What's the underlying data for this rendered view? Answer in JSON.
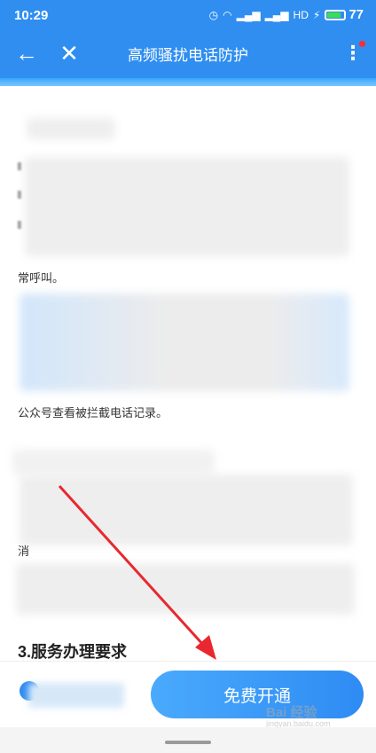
{
  "status_bar": {
    "time": "10:29",
    "icons": [
      "alarm-icon",
      "wifi-icon",
      "signal-icon",
      "signal-icon",
      "hd-icon",
      "charging-icon"
    ],
    "battery": "77"
  },
  "header": {
    "title": "高频骚扰电话防护",
    "back_icon": "←",
    "close_icon": "✕",
    "more_icon": "⋮"
  },
  "content": {
    "line_1_end": "常呼叫。",
    "line_2_end": "公众号查看被拦截电话记录。",
    "line_3_fragment": "消",
    "section_3_heading": "3.服务办理要求"
  },
  "bottom": {
    "cta_label": "免费开通"
  },
  "watermark": {
    "text": "Bai 经验",
    "sub": "jingyan.baidu.com"
  },
  "colors": {
    "brand_blue": "#2f8ef0",
    "annotation_red": "#e8282e"
  }
}
